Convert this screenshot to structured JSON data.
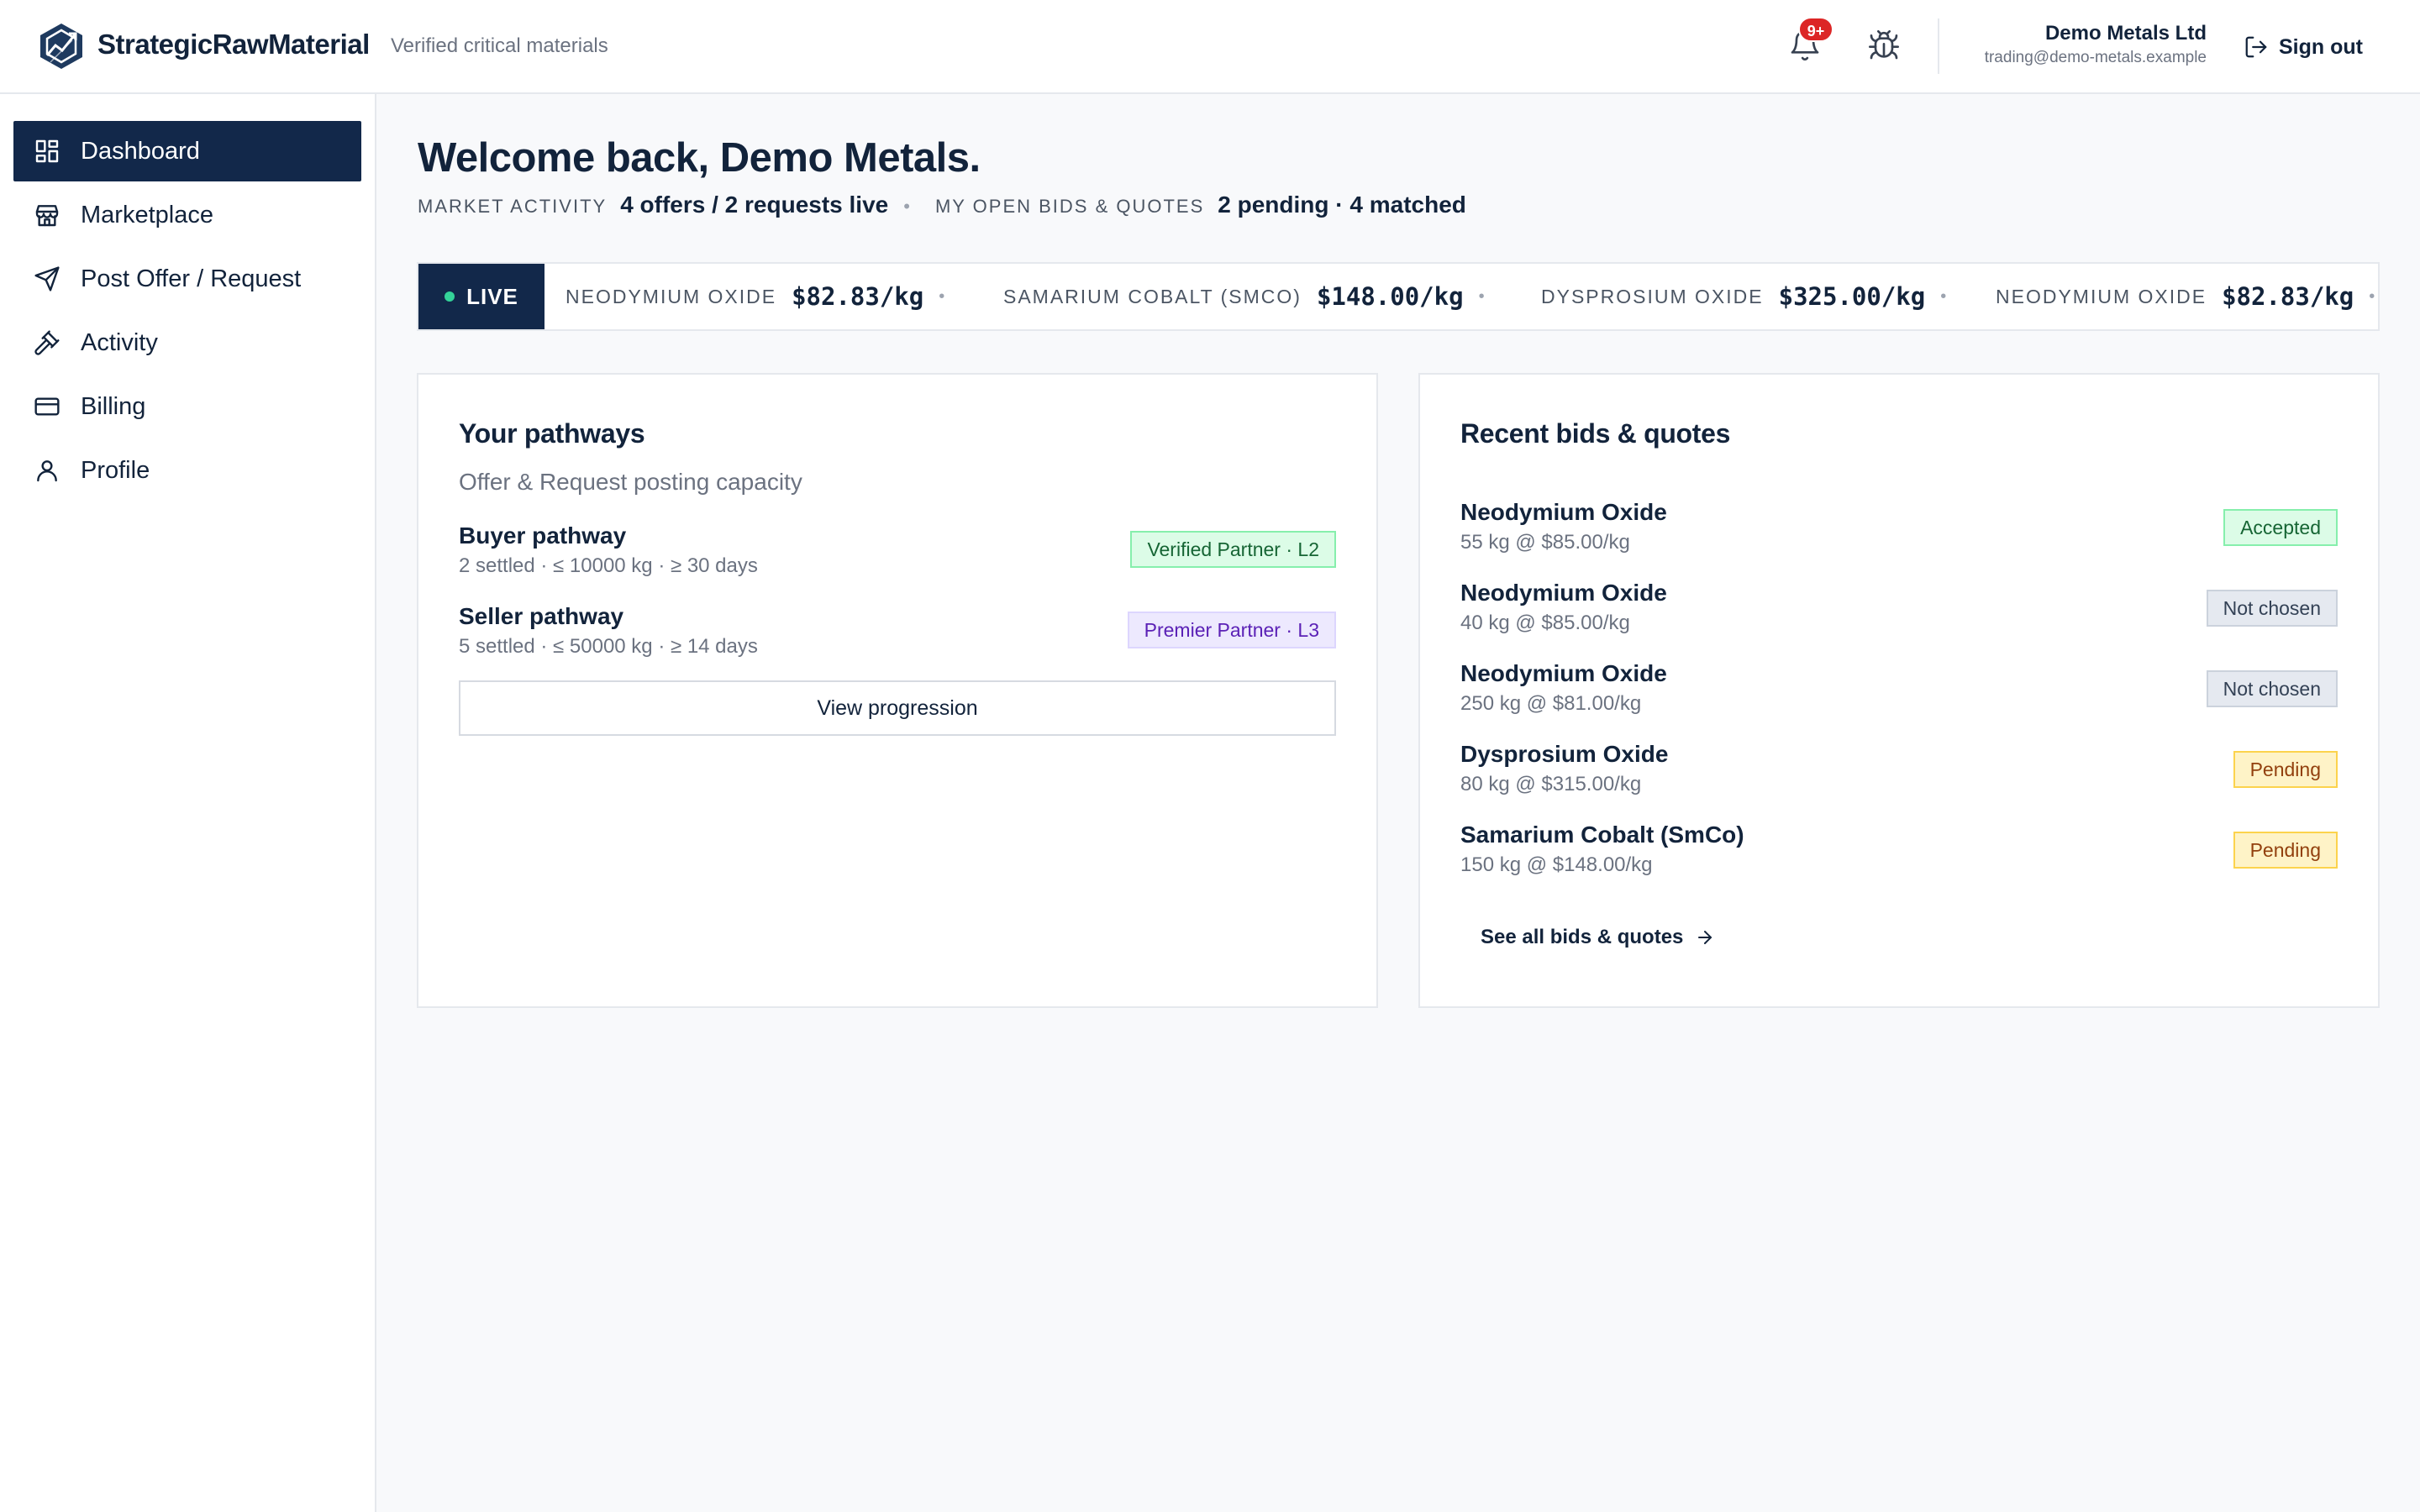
{
  "brand": {
    "name": "StrategicRawMaterial",
    "tagline": "Verified critical materials"
  },
  "header": {
    "notifications_badge": "9+",
    "user_name": "Demo Metals Ltd",
    "user_email": "trading@demo-metals.example",
    "signout_label": "Sign out"
  },
  "sidebar": {
    "items": [
      {
        "label": "Dashboard",
        "icon": "dashboard-icon",
        "active": true
      },
      {
        "label": "Marketplace",
        "icon": "store-icon"
      },
      {
        "label": "Post Offer / Request",
        "icon": "send-icon"
      },
      {
        "label": "Activity",
        "icon": "gavel-icon"
      },
      {
        "label": "Billing",
        "icon": "credit-card-icon"
      },
      {
        "label": "Profile",
        "icon": "user-icon"
      }
    ]
  },
  "main": {
    "welcome": "Welcome back, Demo Metals.",
    "market_activity_label": "MARKET ACTIVITY",
    "market_activity_value": "4 offers / 2 requests live",
    "open_bids_label": "MY OPEN BIDS & QUOTES",
    "open_bids_value": "2 pending · 4 matched"
  },
  "ticker": {
    "live_label": "LIVE",
    "items": [
      {
        "name": "NEODYMIUM OXIDE",
        "price": "$82.83/kg"
      },
      {
        "name": "SAMARIUM COBALT (SMCO)",
        "price": "$148.00/kg"
      },
      {
        "name": "DYSPROSIUM OXIDE",
        "price": "$325.00/kg"
      },
      {
        "name": "NEODYMIUM OXIDE",
        "price": "$82.83/kg"
      }
    ]
  },
  "pathways": {
    "title": "Your pathways",
    "subtitle": "Offer & Request posting capacity",
    "items": [
      {
        "title": "Buyer pathway",
        "meta": "2 settled · ≤ 10000 kg · ≥ 30 days",
        "tier": "Verified Partner · L2"
      },
      {
        "title": "Seller pathway",
        "meta": "5 settled · ≤ 50000 kg · ≥ 14 days",
        "tier": "Premier Partner · L3"
      }
    ],
    "button_label": "View progression"
  },
  "bids": {
    "title": "Recent bids & quotes",
    "items": [
      {
        "material": "Neodymium Oxide",
        "detail": "55 kg @ $85.00/kg",
        "status": "Accepted"
      },
      {
        "material": "Neodymium Oxide",
        "detail": "40 kg @ $85.00/kg",
        "status": "Not chosen"
      },
      {
        "material": "Neodymium Oxide",
        "detail": "250 kg @ $81.00/kg",
        "status": "Not chosen"
      },
      {
        "material": "Dysprosium Oxide",
        "detail": "80 kg @ $315.00/kg",
        "status": "Pending"
      },
      {
        "material": "Samarium Cobalt (SmCo)",
        "detail": "150 kg @ $148.00/kg",
        "status": "Pending"
      }
    ],
    "see_all_label": "See all bids & quotes"
  },
  "colors": {
    "navy": "#12284a",
    "accepted": "#dcfce7",
    "pending": "#fef3c7",
    "not_chosen": "#e5e9f0",
    "premier": "#ede9fe",
    "badge_red": "#dc2626",
    "live_dot": "#34d399"
  }
}
